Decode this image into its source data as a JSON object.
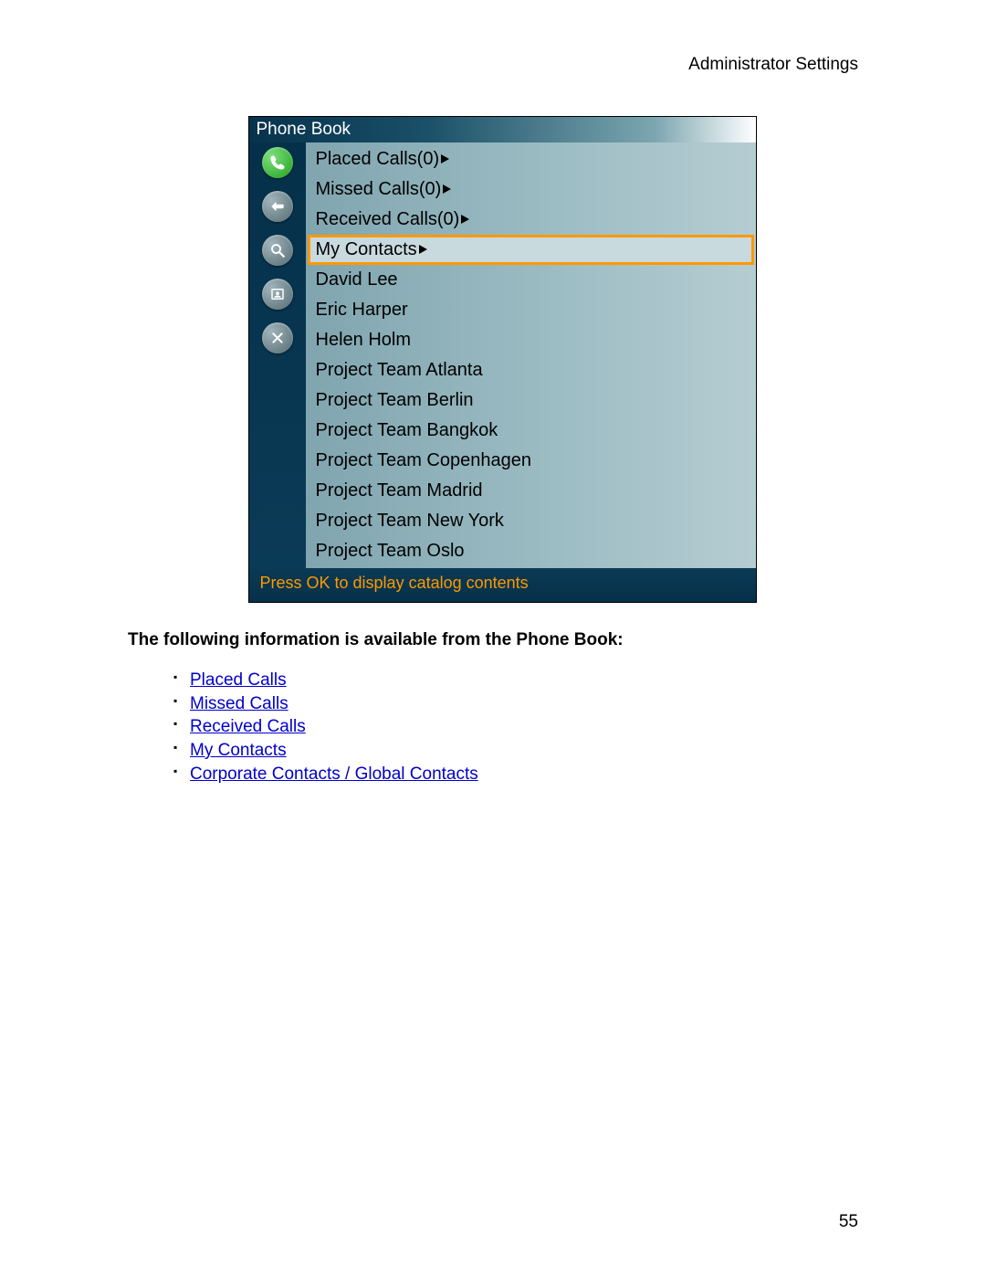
{
  "header": {
    "title": "Administrator Settings"
  },
  "phonebook": {
    "title": "Phone Book",
    "folders": [
      {
        "label": "Placed Calls(0)",
        "selected": false
      },
      {
        "label": "Missed Calls(0)",
        "selected": false
      },
      {
        "label": "Received Calls(0)",
        "selected": false
      },
      {
        "label": "My Contacts",
        "selected": true
      }
    ],
    "contacts": [
      "David Lee",
      "Eric Harper",
      "Helen Holm",
      "Project Team Atlanta",
      "Project Team Berlin",
      "Project Team Bangkok",
      "Project Team Copenhagen",
      "Project Team Madrid",
      "Project Team New York",
      "Project Team Oslo"
    ],
    "footer": "Press OK to display catalog contents"
  },
  "section": {
    "heading": "The following information is available from the Phone Book:",
    "links": [
      "Placed Calls",
      "Missed Calls",
      "Received Calls",
      "My Contacts",
      "Corporate Contacts / Global Contacts"
    ]
  },
  "page_number": "55"
}
